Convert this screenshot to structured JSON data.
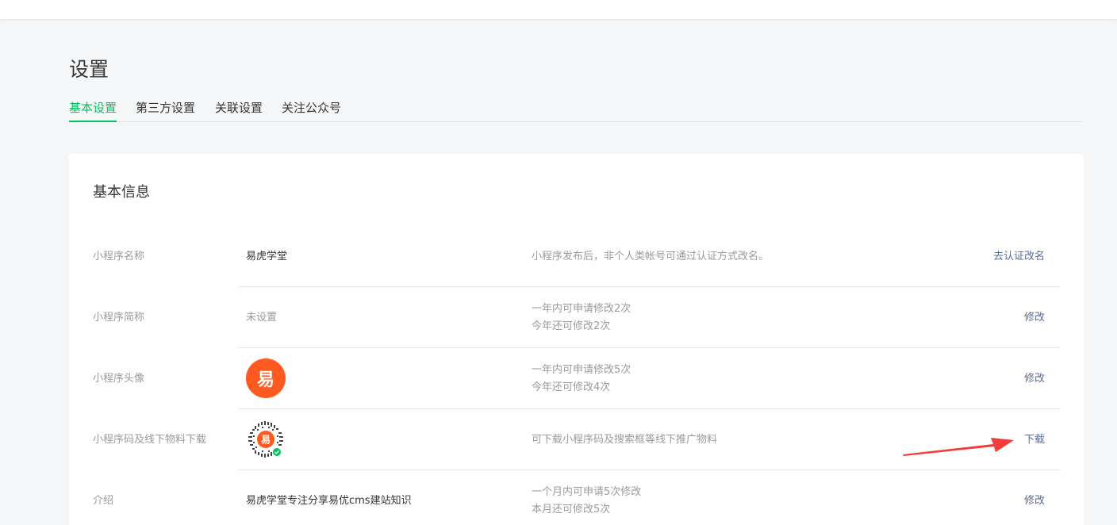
{
  "page": {
    "title": "设置"
  },
  "tabs": [
    {
      "label": "基本设置",
      "active": true
    },
    {
      "label": "第三方设置",
      "active": false
    },
    {
      "label": "关联设置",
      "active": false
    },
    {
      "label": "关注公众号",
      "active": false
    }
  ],
  "card": {
    "title": "基本信息"
  },
  "rows": {
    "name": {
      "label": "小程序名称",
      "value": "易虎学堂",
      "desc1": "小程序发布后，非个人类帐号可通过认证方式改名。",
      "action": "去认证改名"
    },
    "short_name": {
      "label": "小程序简称",
      "value": "未设置",
      "desc1": "一年内可申请修改2次",
      "desc2": "今年还可修改2次",
      "action": "修改"
    },
    "avatar": {
      "label": "小程序头像",
      "avatar_text": "易",
      "desc1": "一年内可申请修改5次",
      "desc2": "今年还可修改4次",
      "action": "修改"
    },
    "qrcode": {
      "label": "小程序码及线下物料下载",
      "qr_center_text": "易",
      "desc1": "可下载小程序码及搜索框等线下推广物料",
      "action": "下载"
    },
    "intro": {
      "label": "介绍",
      "value": "易虎学堂专注分享易优cms建站知识",
      "desc1": "一个月内可申请5次修改",
      "desc2": "本月还可修改5次",
      "action": "修改"
    }
  },
  "colors": {
    "accent": "#07c160",
    "link": "#576b95",
    "avatar_bg": "#ff5a1f",
    "annotation_arrow": "#f23b3b"
  }
}
